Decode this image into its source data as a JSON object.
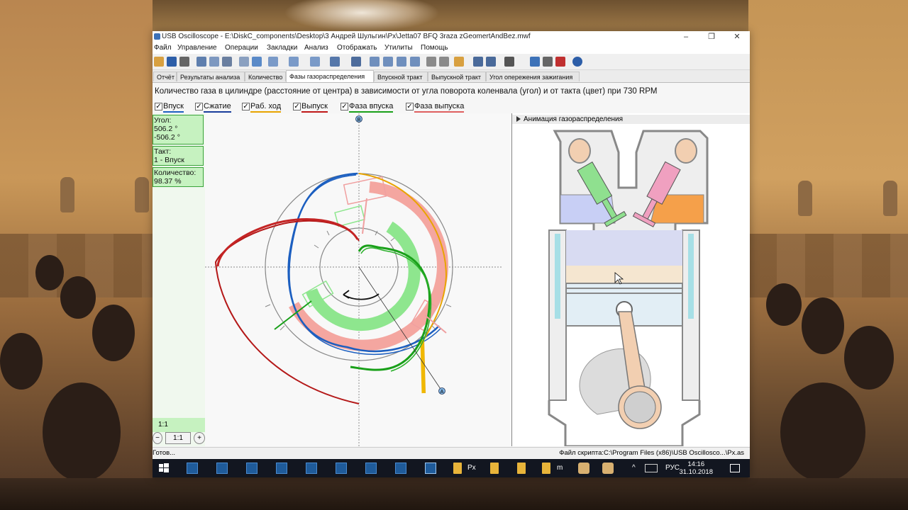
{
  "window": {
    "title": "USB Oscilloscope - E:\\DiskC_components\\Desktop\\3 Андрей Шульгин\\Px\\Jetta07 BFQ 3raza zGeomertAndBez.mwf",
    "buttons": {
      "minimize": "–",
      "maximize": "❐",
      "close": "✕"
    }
  },
  "menu": [
    "Файл",
    "Управление",
    "Операции",
    "Закладки",
    "Анализ",
    "Отображать",
    "Утилиты",
    "Помощь"
  ],
  "tabs": [
    {
      "label": "Отчёт",
      "active": false
    },
    {
      "label": "Результаты анализа",
      "active": false
    },
    {
      "label": "Количество",
      "active": false
    },
    {
      "label": "Фазы газораспределения",
      "active": true
    },
    {
      "label": "Впускной тракт",
      "active": false
    },
    {
      "label": "Выпускной тракт",
      "active": false
    },
    {
      "label": "Угол опережения зажигания",
      "active": false
    }
  ],
  "caption": "Количество газа в цилиндре (расстояние от центра) в зависимости от угла поворота коленвала (угол) и от такта (цвет) при 730 RPM",
  "legend": [
    {
      "label": "Впуск",
      "color": "#1c5fc0",
      "checked": true
    },
    {
      "label": "Сжатие",
      "color": "#1a3e9c",
      "checked": true
    },
    {
      "label": "Раб. ход",
      "color": "#e8a400",
      "checked": true
    },
    {
      "label": "Выпуск",
      "color": "#c01818",
      "checked": true
    },
    {
      "label": "Фаза впуска",
      "color": "#19a019",
      "checked": true
    },
    {
      "label": "Фаза выпуска",
      "color": "#e06060",
      "checked": true
    }
  ],
  "info": {
    "angle_label": "Угол:",
    "angle_value1": "506.2 °",
    "angle_value2": "-506.2 °",
    "stroke_label": "Такт:",
    "stroke_value": "1 - Впуск",
    "amount_label": "Количество:",
    "amount_value": "98.37 %"
  },
  "zoom": {
    "scale": "1:1",
    "minus": "−",
    "reset": "1:1",
    "plus": "+"
  },
  "plot": {
    "marker_top": "B",
    "marker_bottom": "A"
  },
  "animation": {
    "title": "Анимация газораспределения"
  },
  "status": {
    "left": "Готов...",
    "right": "Файл скрипта:C:\\Program Files (x86)\\USB Oscillosco...\\Px.as"
  },
  "taskbar": {
    "folder1": "Px",
    "folder2": "m",
    "lang": "РУС",
    "time": "14:16",
    "date": "31.10.2018"
  },
  "colors": {
    "intake_phase": "#7fe07f",
    "exhaust_phase": "#f4a6a0",
    "intake_trace": "#1c5fc0",
    "compression_trace": "#c01818",
    "exhaust_trace": "#e8a400",
    "green_trace": "#19a019"
  }
}
